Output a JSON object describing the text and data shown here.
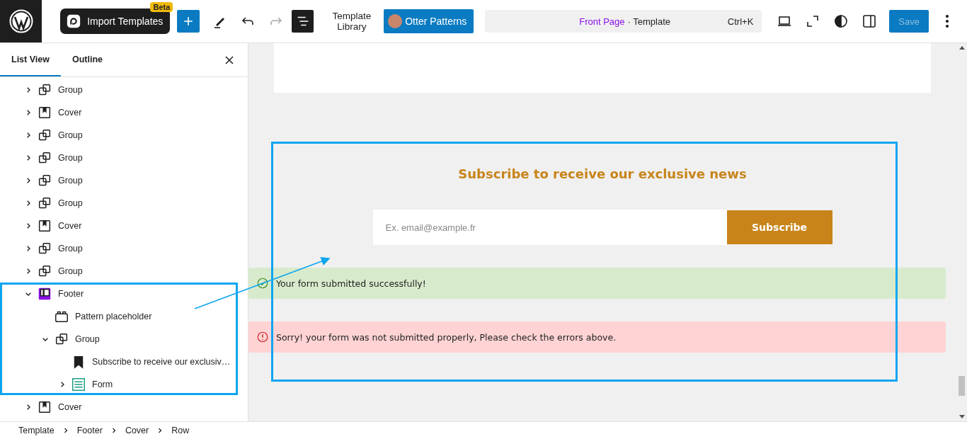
{
  "toolbar": {
    "import_button": "Import Templates",
    "import_badge": "Beta",
    "redo_disabled": true,
    "list_view_on": true,
    "template_library": [
      "Template",
      "Library"
    ],
    "otter_button": "Otter Patterns",
    "document_title": "Front Page",
    "document_type": "· Template",
    "shortcut": "Ctrl+K",
    "save_button": "Save",
    "save_disabled": true
  },
  "sidebar": {
    "tabs": [
      {
        "label": "List View",
        "selected": true
      },
      {
        "label": "Outline",
        "selected": false
      }
    ],
    "items": [
      {
        "kind": "group",
        "label": "Group",
        "expanded": false
      },
      {
        "kind": "cover",
        "label": "Cover",
        "expanded": false
      },
      {
        "kind": "group",
        "label": "Group",
        "expanded": false
      },
      {
        "kind": "group",
        "label": "Group",
        "expanded": false
      },
      {
        "kind": "group",
        "label": "Group",
        "expanded": false
      },
      {
        "kind": "group",
        "label": "Group",
        "expanded": false
      },
      {
        "kind": "cover",
        "label": "Cover",
        "expanded": false
      },
      {
        "kind": "group",
        "label": "Group",
        "expanded": false
      },
      {
        "kind": "group",
        "label": "Group",
        "expanded": false
      },
      {
        "kind": "footer",
        "label": "Footer",
        "expanded": true,
        "children": [
          {
            "kind": "pattern",
            "label": "Pattern placeholder"
          },
          {
            "kind": "group",
            "label": "Group",
            "expanded": true,
            "children": [
              {
                "kind": "heading",
                "label": "Subscribe to receive our exclusiv…"
              },
              {
                "kind": "form",
                "label": "Form",
                "expanded": false
              }
            ]
          }
        ]
      },
      {
        "kind": "cover",
        "label": "Cover",
        "expanded": false
      }
    ]
  },
  "canvas": {
    "heading": "Subscribe to receive our exclusive news",
    "email_placeholder": "Ex. email@example.fr",
    "subscribe_button": "Subscribe",
    "notices": [
      {
        "kind": "success",
        "text": "Your form submitted successfully!"
      },
      {
        "kind": "error",
        "text": "Sorry! your form was not submitted properly, Please check the errors above."
      }
    ]
  },
  "breadcrumbs": [
    "Template",
    "Footer",
    "Cover",
    "Row"
  ]
}
